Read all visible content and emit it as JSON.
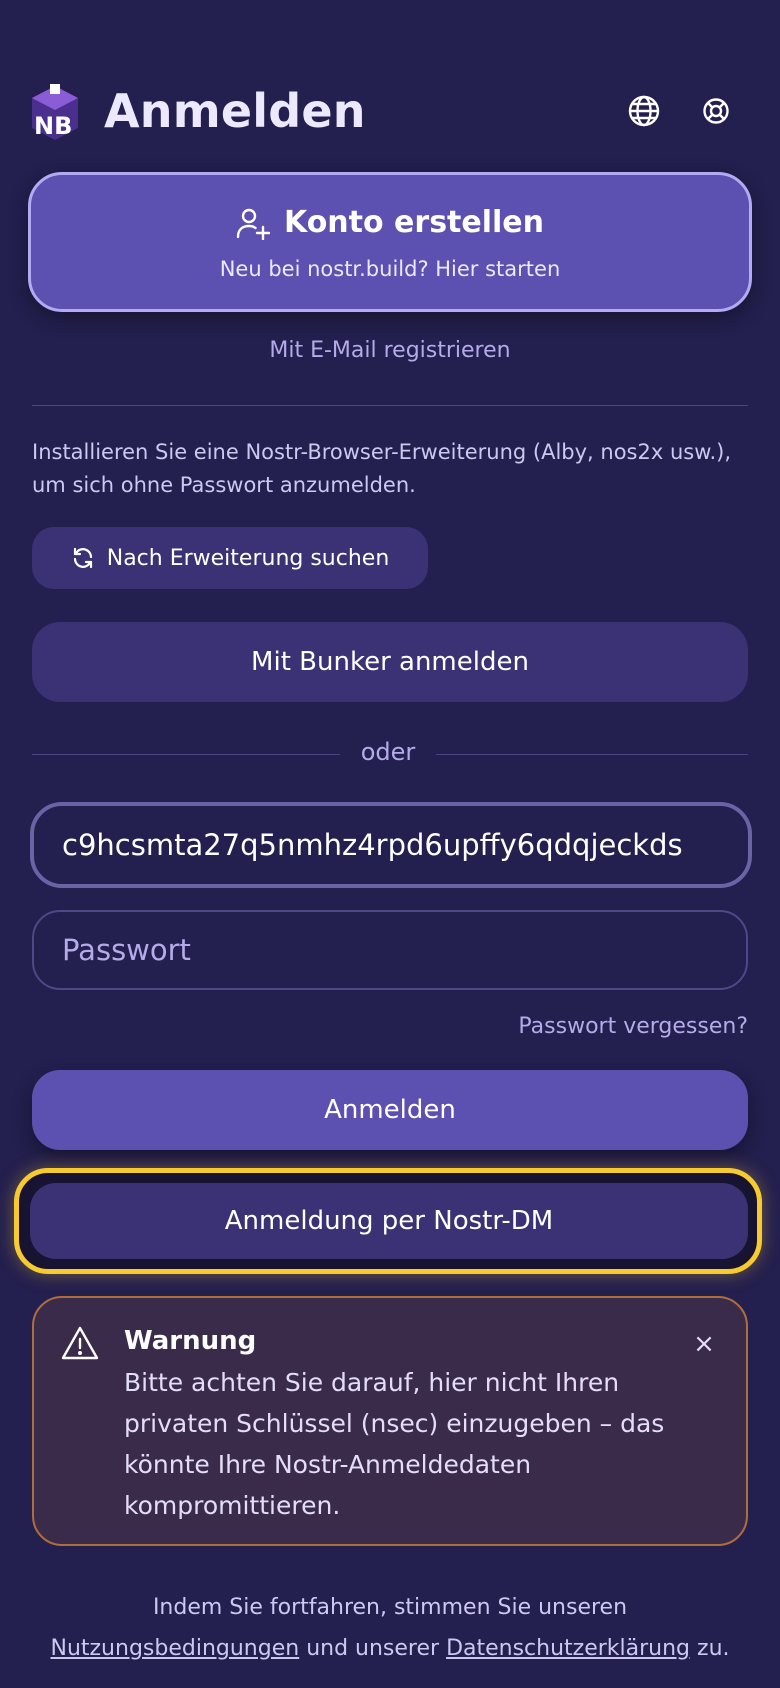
{
  "header": {
    "logo_text": "NB",
    "title": "Anmelden",
    "icons": [
      "globe-icon",
      "lifebuoy-icon"
    ]
  },
  "create_account": {
    "label": "Konto erstellen",
    "subtitle": "Neu bei nostr.build? Hier starten",
    "icon": "user-plus-icon"
  },
  "email_register_link": "Mit E-Mail registrieren",
  "extension_info": "Installieren Sie eine Nostr-Browser-Erweiterung (Alby, nos2x usw.), um sich ohne Passwort anzumelden.",
  "search_extension_label": "Nach Erweiterung suchen",
  "bunker_label": "Mit Bunker anmelden",
  "or_label": "oder",
  "username": {
    "value": "c9hcsmta27q5nmhz4rpd6upffy6qdqjeckds",
    "placeholder": ""
  },
  "password": {
    "value": "",
    "placeholder": "Passwort"
  },
  "forgot_password": "Passwort vergessen?",
  "login_label": "Anmelden",
  "nostr_dm_label": "Anmeldung per Nostr-DM",
  "warning": {
    "title": "Warnung",
    "text": "Bitte achten Sie darauf, hier nicht Ihren privaten Schlüssel (nsec) einzugeben – das könnte Ihre Nostr-Anmeldedaten kompromittieren.",
    "close": "×"
  },
  "footer": {
    "prefix": "Indem Sie fortfahren, stimmen Sie unseren",
    "terms_link": "Nutzungsbedingungen",
    "middle": "und unserer",
    "privacy_link": "Datenschutzerklärung",
    "suffix": "zu."
  },
  "colors": {
    "background": "#231f4e",
    "primary": "#5c51b0",
    "secondary": "#3a3274",
    "highlight": "#f7cb2d",
    "warning_border": "#b06d3c"
  }
}
